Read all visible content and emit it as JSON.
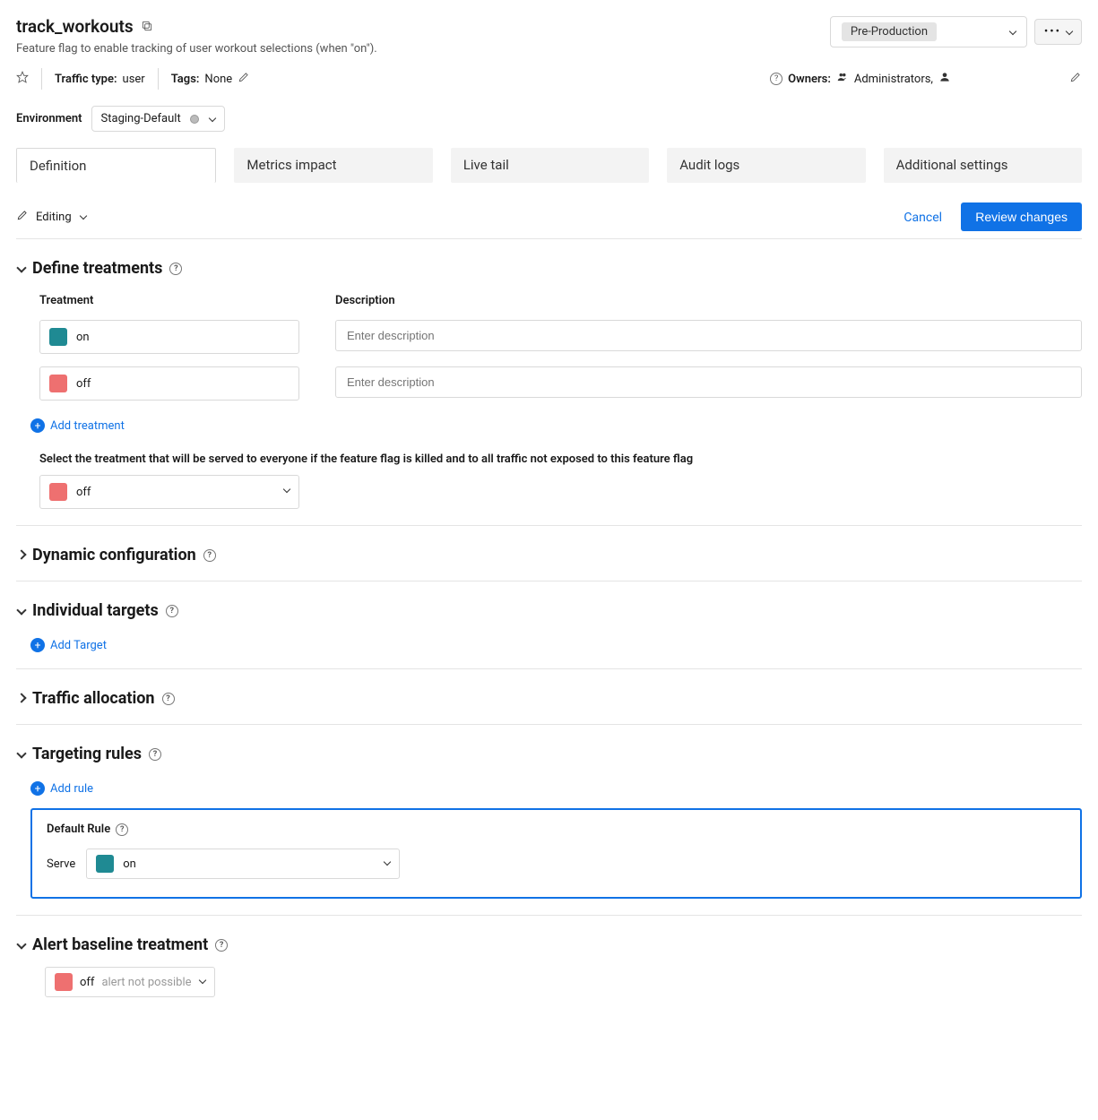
{
  "header": {
    "title": "track_workouts",
    "description": "Feature flag to enable tracking of user workout selections (when \"on\").",
    "environment_selector_label": "Pre-Production"
  },
  "meta": {
    "traffic_type_label": "Traffic type:",
    "traffic_type_value": "user",
    "tags_label": "Tags:",
    "tags_value": "None",
    "owners_label": "Owners:",
    "owners_value": "Administrators,"
  },
  "environment": {
    "label": "Environment",
    "value": "Staging-Default"
  },
  "tabs": {
    "definition": "Definition",
    "metrics": "Metrics impact",
    "livetail": "Live tail",
    "audit": "Audit logs",
    "additional": "Additional settings"
  },
  "editbar": {
    "editing": "Editing",
    "cancel": "Cancel",
    "review": "Review changes"
  },
  "sections": {
    "define_treatments": "Define treatments",
    "dynamic_config": "Dynamic configuration",
    "individual_targets": "Individual targets",
    "traffic_allocation": "Traffic allocation",
    "targeting_rules": "Targeting rules",
    "alert_baseline": "Alert baseline treatment"
  },
  "treatments": {
    "col_treatment": "Treatment",
    "col_description": "Description",
    "on": "on",
    "off": "off",
    "desc_placeholder": "Enter description",
    "add_treatment": "Add treatment",
    "kill_text": "Select the treatment that will be served to everyone if the feature flag is killed and to all traffic not exposed to this feature flag",
    "default_serve": "off"
  },
  "targets": {
    "add_target": "Add Target"
  },
  "rules": {
    "add_rule": "Add rule",
    "default_rule_label": "Default Rule",
    "serve_label": "Serve",
    "serve_value": "on"
  },
  "alert": {
    "value": "off",
    "hint": "alert not possible"
  }
}
